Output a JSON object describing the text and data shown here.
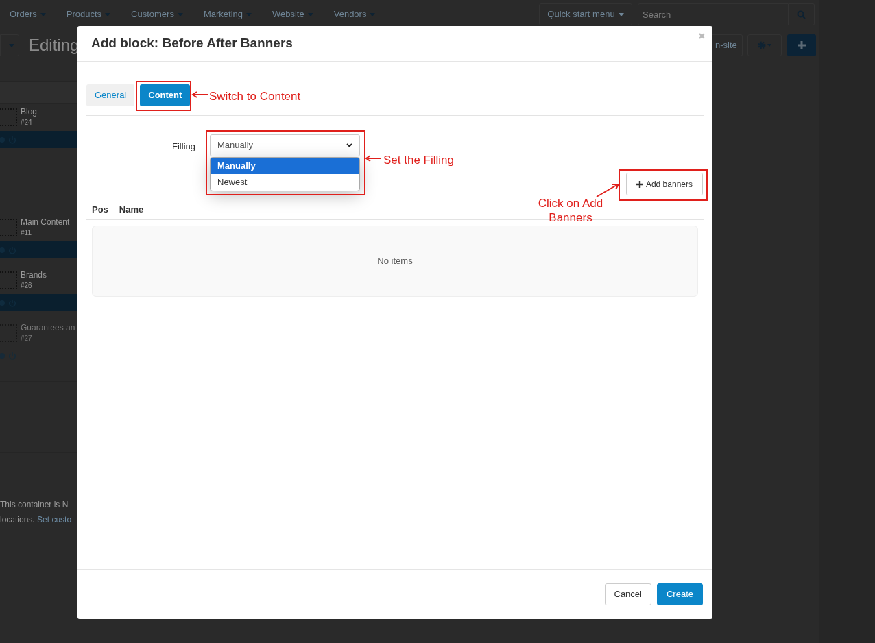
{
  "nav": {
    "menus": [
      "Orders",
      "Products",
      "Customers",
      "Marketing",
      "Website",
      "Vendors"
    ],
    "quick_start": "Quick start menu",
    "search": {
      "placeholder": "Search"
    }
  },
  "toolbar": {
    "title": "Editing",
    "preview_button": "n-site"
  },
  "blocks": [
    {
      "name": "Blog",
      "id": "#24",
      "disabled": false
    },
    {
      "name": "Main Content",
      "id": "#11",
      "disabled": false
    },
    {
      "name": "Brands",
      "id": "#26",
      "disabled": false
    },
    {
      "name": "Guarantees an",
      "id": "#27",
      "disabled": true
    }
  ],
  "container_note": {
    "line_1": "This container is N",
    "line_2": "locations.",
    "link": "Set custo"
  },
  "modal": {
    "title": "Add block: Before After Banners",
    "tabs": [
      {
        "label": "General",
        "selected": false
      },
      {
        "label": "Content",
        "selected": true
      }
    ],
    "filling": {
      "label": "Filling",
      "value": "Manually",
      "expanded": true,
      "options": [
        {
          "label": "Manually",
          "selected": true
        },
        {
          "label": "Newest",
          "selected": false
        }
      ]
    },
    "add_button": "Add banners",
    "columns": [
      "Pos",
      "Name"
    ],
    "empty_text": "No items",
    "buttons": [
      {
        "label": "Cancel",
        "kind": "default"
      },
      {
        "label": "Create",
        "kind": "primary"
      }
    ]
  },
  "annotations": [
    {
      "text": "Switch to Content"
    },
    {
      "text": "Set the Filling"
    },
    {
      "text": "Click on Add Banners"
    }
  ]
}
